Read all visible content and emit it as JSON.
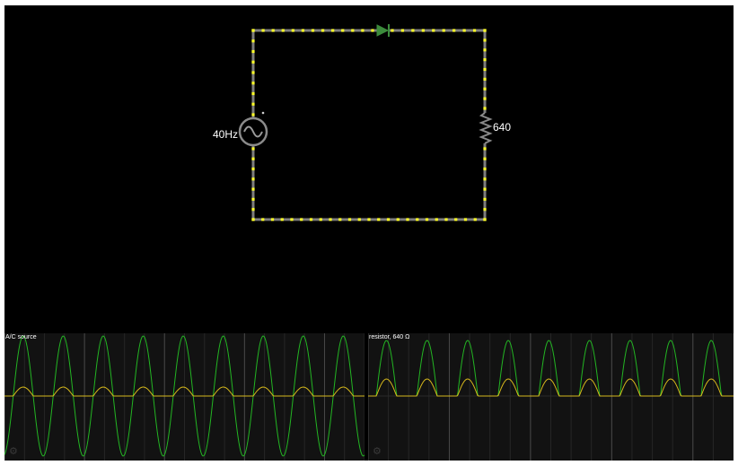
{
  "circuit": {
    "source_label": "40Hz",
    "resistor_label": "640",
    "wire_color": "#7d7d7d",
    "dot_color": "#ffff2a",
    "element_color": "#8a8a8a",
    "diode_color": "#3c8b3c"
  },
  "scopes": [
    {
      "title": "A/C source",
      "cycles": 9,
      "voltage_color": "#23b523",
      "current_color": "#d6b81c"
    },
    {
      "title": "resistor, 640 Ω",
      "cycles": 9,
      "voltage_color": "#23b523",
      "current_color": "#d6b81c"
    }
  ],
  "icons": {
    "settings": "gear-icon",
    "source": "ac-source-icon",
    "diode": "diode-icon",
    "resistor": "resistor-icon"
  }
}
